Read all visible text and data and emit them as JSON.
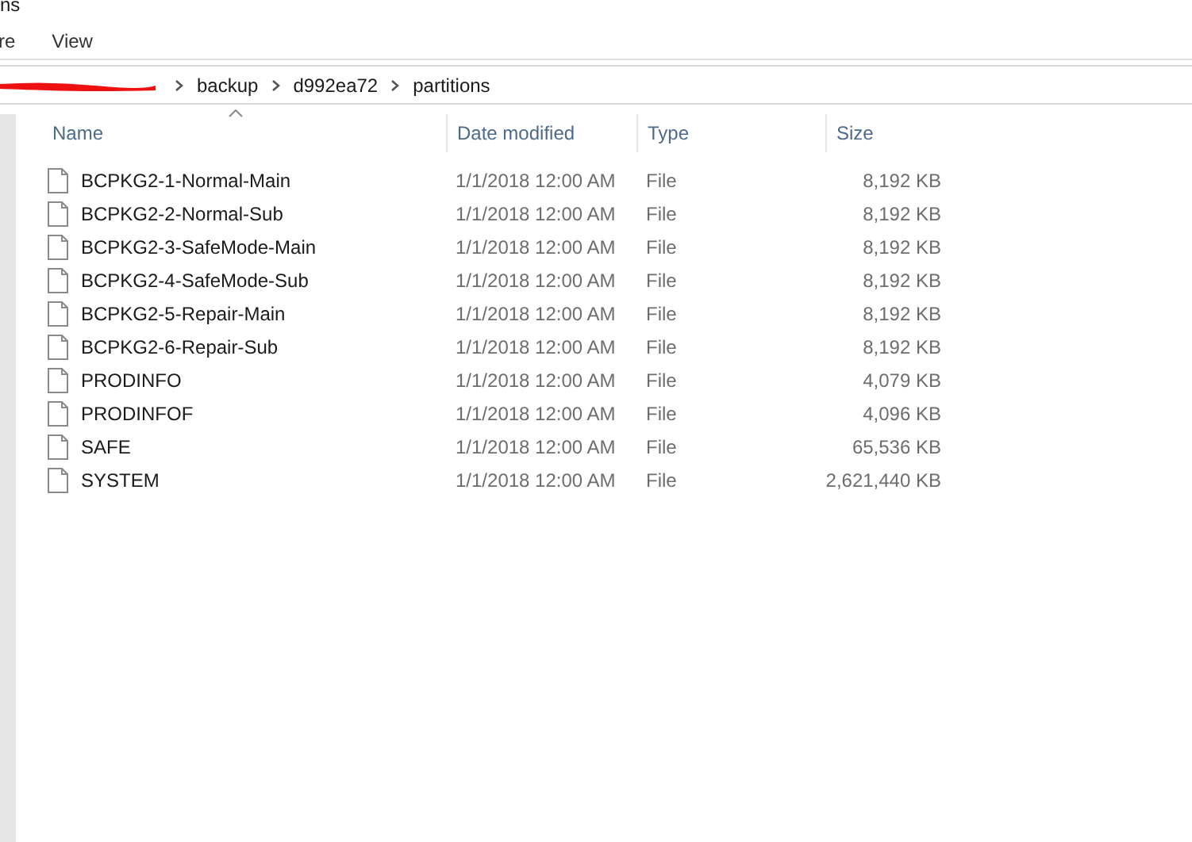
{
  "window": {
    "title": "ns"
  },
  "ribbon_tabs": [
    "re",
    "View"
  ],
  "breadcrumb": [
    "backup",
    "d992ea72",
    "partitions"
  ],
  "columns": [
    {
      "label": "Name",
      "sorted": true
    },
    {
      "label": "Date modified",
      "sorted": false
    },
    {
      "label": "Type",
      "sorted": false
    },
    {
      "label": "Size",
      "sorted": false
    }
  ],
  "files": [
    {
      "name": "BCPKG2-1-Normal-Main",
      "date": "1/1/2018 12:00 AM",
      "type": "File",
      "size": "8,192 KB"
    },
    {
      "name": "BCPKG2-2-Normal-Sub",
      "date": "1/1/2018 12:00 AM",
      "type": "File",
      "size": "8,192 KB"
    },
    {
      "name": "BCPKG2-3-SafeMode-Main",
      "date": "1/1/2018 12:00 AM",
      "type": "File",
      "size": "8,192 KB"
    },
    {
      "name": "BCPKG2-4-SafeMode-Sub",
      "date": "1/1/2018 12:00 AM",
      "type": "File",
      "size": "8,192 KB"
    },
    {
      "name": "BCPKG2-5-Repair-Main",
      "date": "1/1/2018 12:00 AM",
      "type": "File",
      "size": "8,192 KB"
    },
    {
      "name": "BCPKG2-6-Repair-Sub",
      "date": "1/1/2018 12:00 AM",
      "type": "File",
      "size": "8,192 KB"
    },
    {
      "name": "PRODINFO",
      "date": "1/1/2018 12:00 AM",
      "type": "File",
      "size": "4,079 KB"
    },
    {
      "name": "PRODINFOF",
      "date": "1/1/2018 12:00 AM",
      "type": "File",
      "size": "4,096 KB"
    },
    {
      "name": "SAFE",
      "date": "1/1/2018 12:00 AM",
      "type": "File",
      "size": "65,536 KB"
    },
    {
      "name": "SYSTEM",
      "date": "1/1/2018 12:00 AM",
      "type": "File",
      "size": "2,621,440 KB"
    }
  ]
}
